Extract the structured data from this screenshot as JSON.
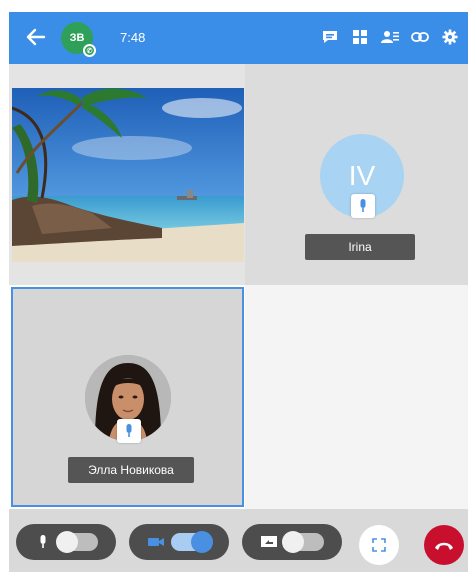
{
  "header": {
    "back_icon": "arrow-left-icon",
    "avatar_initials": "ЗВ",
    "time": "7:48",
    "icons": [
      "chat-icon",
      "grid-layout-icon",
      "participants-icon",
      "link-icon",
      "settings-icon"
    ],
    "color": "#3b8ee8"
  },
  "tiles": [
    {
      "type": "video",
      "content": "beach-scene"
    },
    {
      "type": "avatar",
      "initials": "IV",
      "name": "Irina",
      "mic": "mic-icon"
    },
    {
      "type": "photo",
      "name": "Элла Новикова",
      "mic": "mic-icon",
      "active": true
    },
    {
      "type": "empty"
    }
  ],
  "controls": {
    "mic": {
      "icon": "mic-icon",
      "enabled": false
    },
    "camera": {
      "icon": "camera-icon",
      "enabled": true
    },
    "screen": {
      "icon": "screen-share-icon",
      "enabled": false
    },
    "fullscreen_icon": "fullscreen-icon",
    "hangup_icon": "hang-up-icon",
    "accent_color": "#4a90e2",
    "hangup_color": "#c8102e"
  }
}
